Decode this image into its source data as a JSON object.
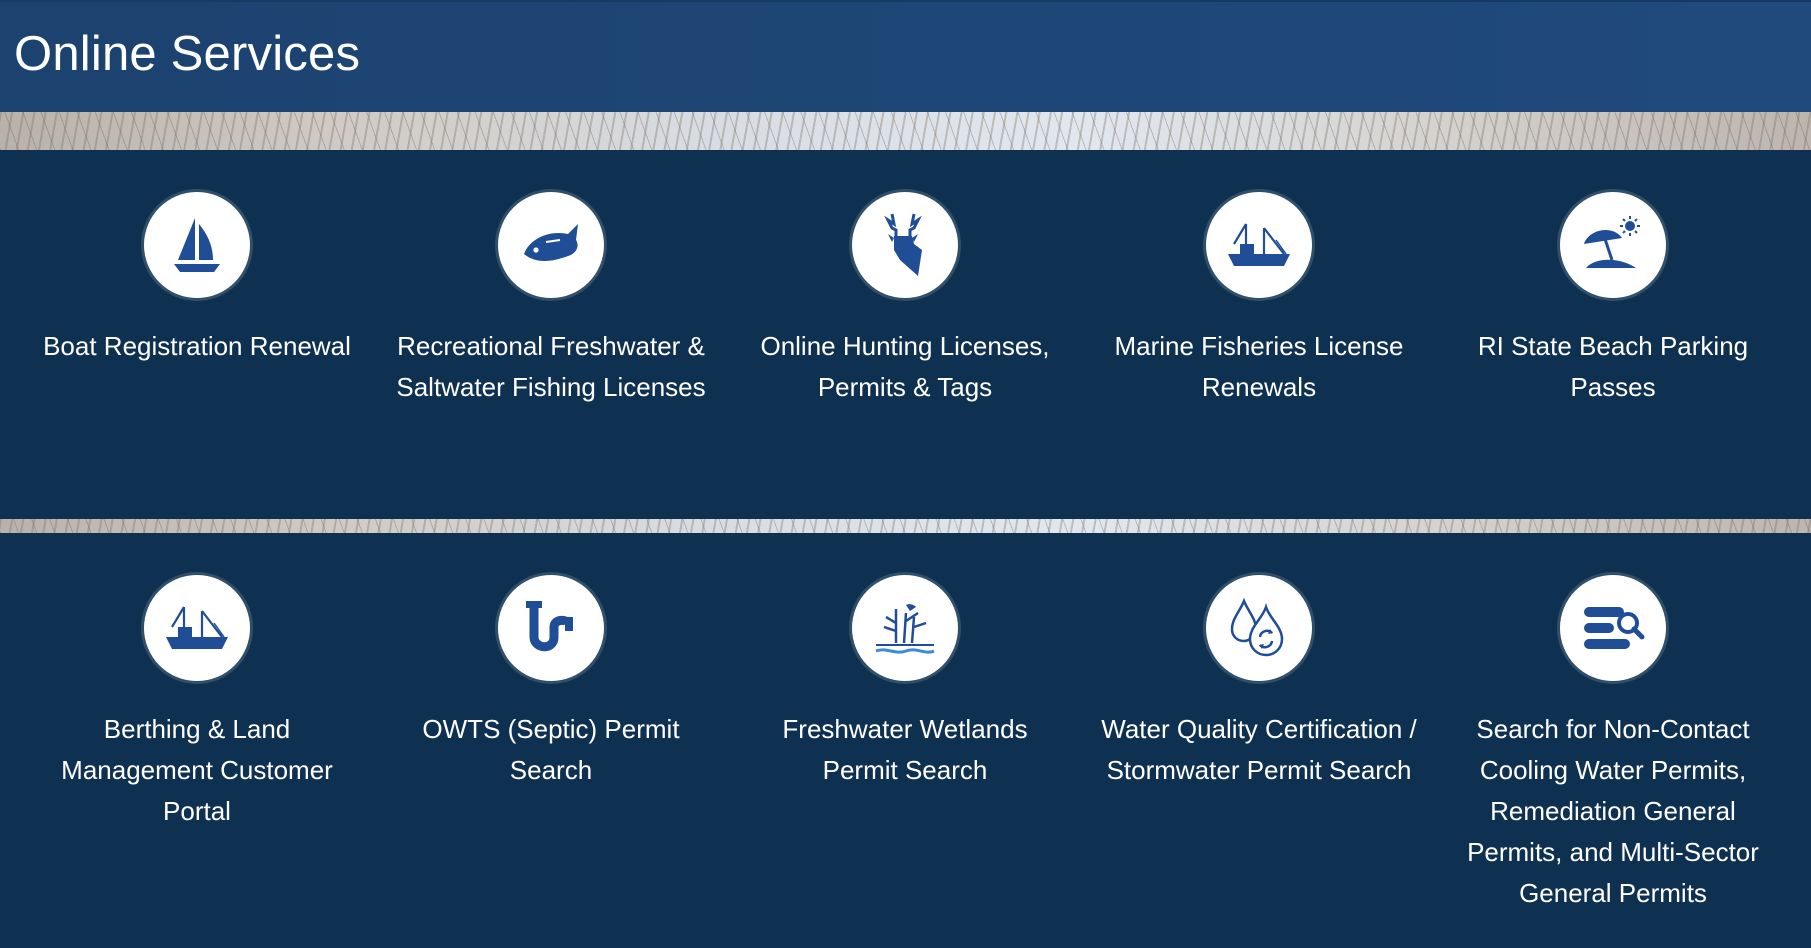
{
  "header": {
    "title": "Online Services"
  },
  "colors": {
    "header_bg": "#1f4677",
    "band_bg": "#0f3151",
    "icon_fill": "#1f4e96",
    "icon_circle": "#ffffff"
  },
  "rows": [
    {
      "tiles": [
        {
          "label": "Boat Registration Renewal",
          "icon": "sailboat-icon"
        },
        {
          "label": "Recreational Freshwater & Saltwater Fishing Licenses",
          "icon": "fish-icon"
        },
        {
          "label": "Online Hunting Licenses, Permits & Tags",
          "icon": "deer-icon"
        },
        {
          "label": "Marine Fisheries License Renewals",
          "icon": "fishing-boat-icon"
        },
        {
          "label": "RI State Beach Parking Passes",
          "icon": "beach-umbrella-icon"
        }
      ]
    },
    {
      "tiles": [
        {
          "label": "Berthing & Land Management Customer Portal",
          "icon": "fishing-boat-icon"
        },
        {
          "label": "OWTS (Septic) Permit Search",
          "icon": "septic-pipe-icon"
        },
        {
          "label": "Freshwater Wetlands Permit Search",
          "icon": "wetlands-icon"
        },
        {
          "label": "Water Quality Certification / Stormwater Permit Search",
          "icon": "water-drops-icon"
        },
        {
          "label": "Search for Non-Contact Cooling Water Permits, Remediation General Permits, and Multi-Sector General Permits",
          "icon": "document-search-icon"
        }
      ]
    }
  ]
}
